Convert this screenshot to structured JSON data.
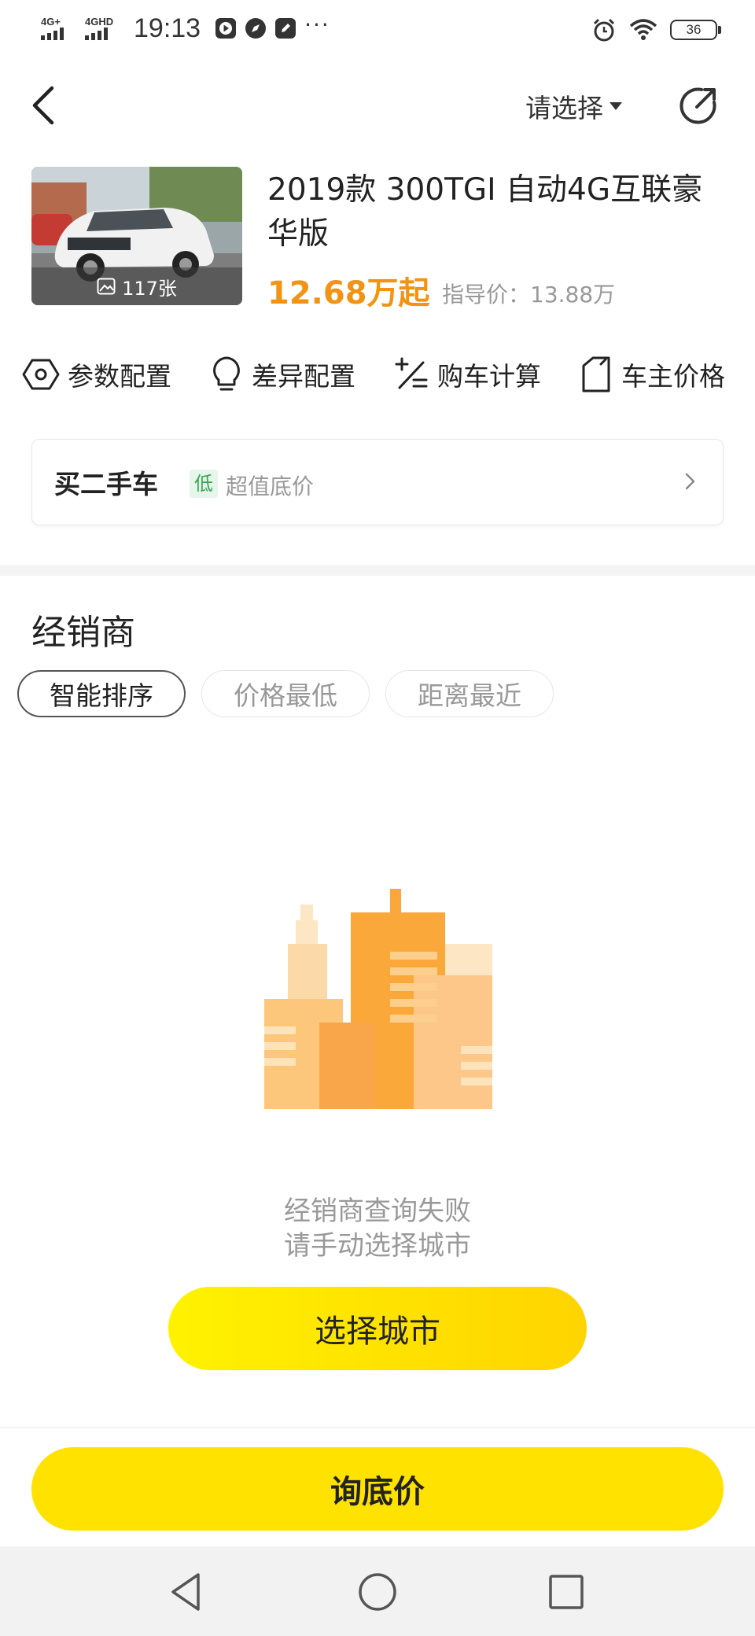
{
  "status_bar": {
    "network1": "4G+",
    "network2": "4GHD",
    "time": "19:13",
    "more": "···",
    "battery": "36"
  },
  "header": {
    "selector_label": "请选择"
  },
  "car": {
    "title": "2019款 300TGI 自动4G互联豪华版",
    "photo_count": "117张",
    "price": "12.68万起",
    "guide_price": "指导价：13.88万"
  },
  "features": [
    {
      "label": "参数配置",
      "icon": "hexagon-settings-icon"
    },
    {
      "label": "差异配置",
      "icon": "lightbulb-icon"
    },
    {
      "label": "购车计算",
      "icon": "calculator-icon"
    },
    {
      "label": "车主价格",
      "icon": "price-tag-icon"
    }
  ],
  "used_car": {
    "title": "买二手车",
    "badge": "低",
    "subtitle": "超值底价"
  },
  "dealers": {
    "title": "经销商",
    "sort_options": [
      "智能排序",
      "价格最低",
      "距离最近"
    ],
    "active_sort": "智能排序",
    "empty_line1": "经销商查询失败",
    "empty_line2": "请手动选择城市",
    "select_city_button": "选择城市"
  },
  "bottom": {
    "quote_button": "询底价"
  },
  "colors": {
    "price": "#f29313",
    "primary_button": "#ffe200",
    "badge_green": "#3aa656"
  }
}
